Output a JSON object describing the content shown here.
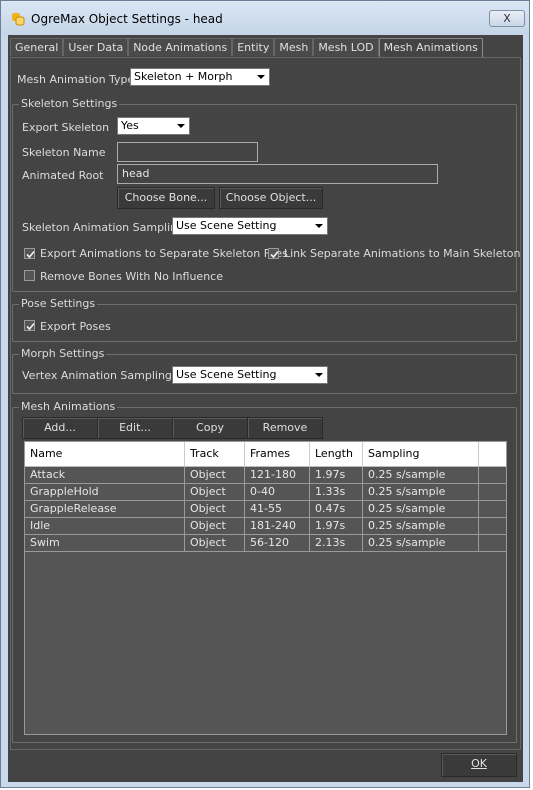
{
  "window": {
    "title": "OgreMax Object Settings - head",
    "close_label": "X"
  },
  "tabs": [
    {
      "label": "General"
    },
    {
      "label": "User Data"
    },
    {
      "label": "Node Animations"
    },
    {
      "label": "Entity"
    },
    {
      "label": "Mesh"
    },
    {
      "label": "Mesh LOD"
    },
    {
      "label": "Mesh Animations",
      "active": true
    }
  ],
  "mesh_animation_type": {
    "label": "Mesh Animation Type",
    "value": "Skeleton + Morph"
  },
  "skeleton_settings": {
    "title": "Skeleton Settings",
    "export_skeleton": {
      "label": "Export Skeleton",
      "value": "Yes"
    },
    "skeleton_name": {
      "label": "Skeleton Name",
      "value": ""
    },
    "animated_root": {
      "label": "Animated Root",
      "value": "head"
    },
    "choose_bone": "Choose Bone...",
    "choose_object": "Choose Object...",
    "sampling": {
      "label": "Skeleton Animation Sampling",
      "value": "Use Scene Setting"
    },
    "export_separate": {
      "label": "Export Animations to Separate Skeleton Files",
      "checked": true
    },
    "link_separate": {
      "label": "Link Separate Animations to Main Skeleton",
      "checked": true
    },
    "remove_bones": {
      "label": "Remove Bones With No Influence",
      "checked": false
    }
  },
  "pose_settings": {
    "title": "Pose Settings",
    "export_poses": {
      "label": "Export Poses",
      "checked": true
    }
  },
  "morph_settings": {
    "title": "Morph Settings",
    "sampling": {
      "label": "Vertex Animation Sampling",
      "value": "Use Scene Setting"
    }
  },
  "mesh_animations": {
    "title": "Mesh Animations",
    "buttons": {
      "add": "Add...",
      "edit": "Edit...",
      "copy": "Copy",
      "remove": "Remove"
    },
    "columns": [
      "Name",
      "Track",
      "Frames",
      "Length",
      "Sampling"
    ],
    "rows": [
      [
        "Attack",
        "Object",
        "121-180",
        "1.97s",
        "0.25 s/sample"
      ],
      [
        "GrappleHold",
        "Object",
        "0-40",
        "1.33s",
        "0.25 s/sample"
      ],
      [
        "GrappleRelease",
        "Object",
        "41-55",
        "0.47s",
        "0.25 s/sample"
      ],
      [
        "Idle",
        "Object",
        "181-240",
        "1.97s",
        "0.25 s/sample"
      ],
      [
        "Swim",
        "Object",
        "56-120",
        "2.13s",
        "0.25 s/sample"
      ]
    ]
  },
  "ok_label": "OK",
  "colors": {
    "panel_bg": "#444444",
    "title_bar": "#c4d5e9",
    "app_icon": "#f2b21a"
  }
}
